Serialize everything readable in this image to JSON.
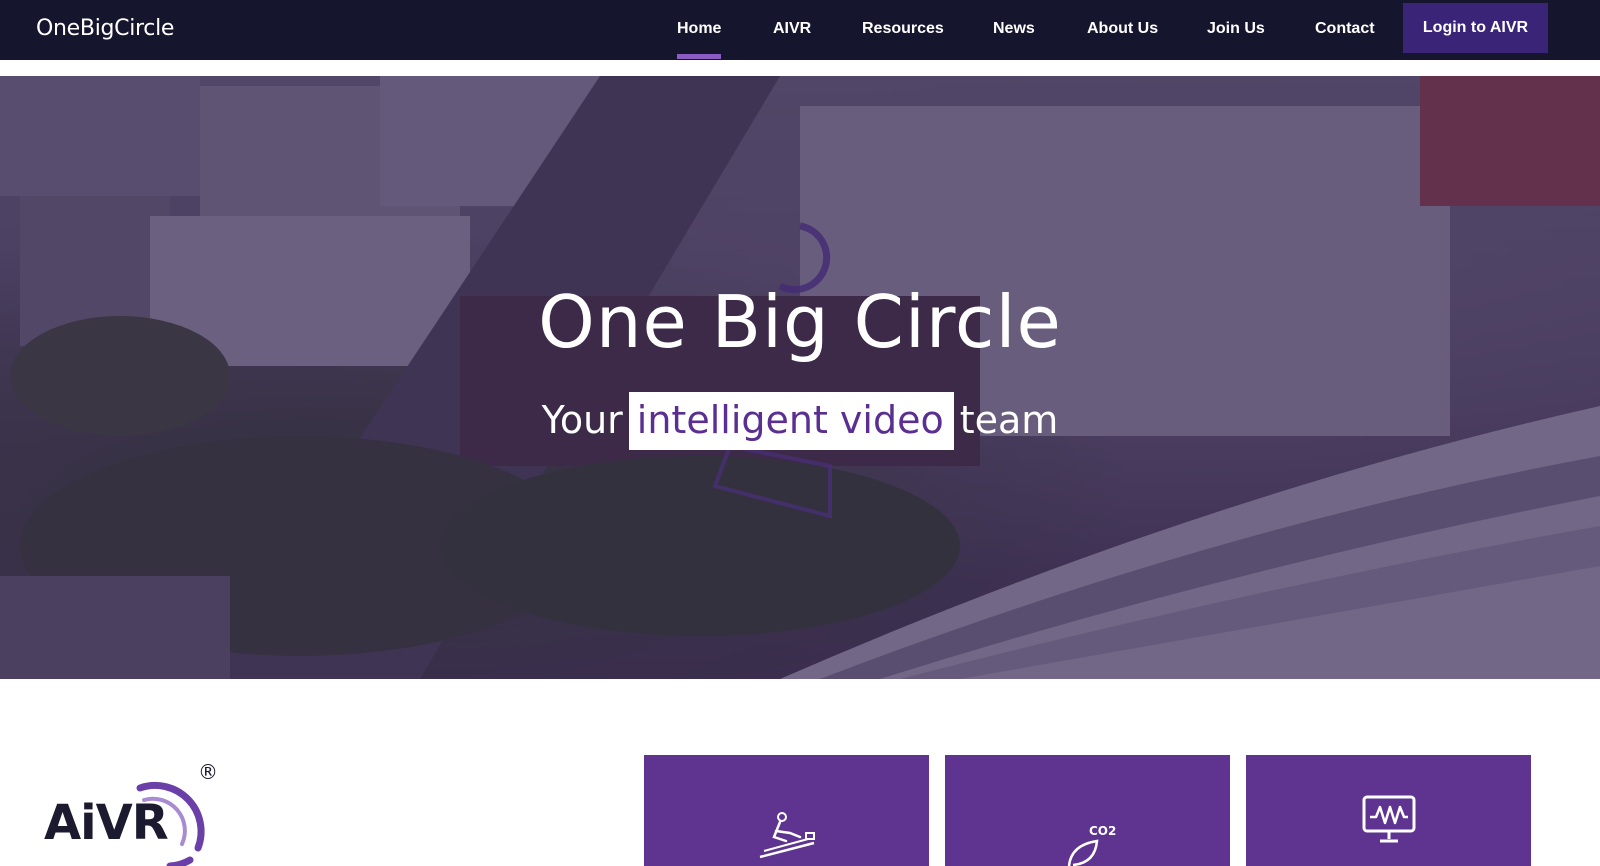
{
  "header": {
    "brand": "OneBigCircle",
    "nav": [
      {
        "label": "Home",
        "active": true
      },
      {
        "label": "AIVR",
        "active": false
      },
      {
        "label": "Resources",
        "active": false
      },
      {
        "label": "News",
        "active": false
      },
      {
        "label": "About Us",
        "active": false
      },
      {
        "label": "Join Us",
        "active": false
      },
      {
        "label": "Contact",
        "active": false
      }
    ],
    "login_label": "Login to AIVR"
  },
  "hero": {
    "title": "One Big Circle",
    "subtitle_before": "Your",
    "subtitle_highlight": "intelligent video",
    "subtitle_after": "team"
  },
  "aivr_logo": {
    "wordmark": "AiVR",
    "registered": "®"
  },
  "features": [
    {
      "icon": "track-worker-icon"
    },
    {
      "icon": "co2-leaf-icon",
      "icon_text": "CO2"
    },
    {
      "icon": "monitor-waveform-icon"
    }
  ],
  "colors": {
    "nav_background": "#16152e",
    "accent_purple": "#5e3490",
    "login_button": "#3a2478",
    "active_underline": "#8a5cc4",
    "highlight_text": "#5a2f91"
  }
}
